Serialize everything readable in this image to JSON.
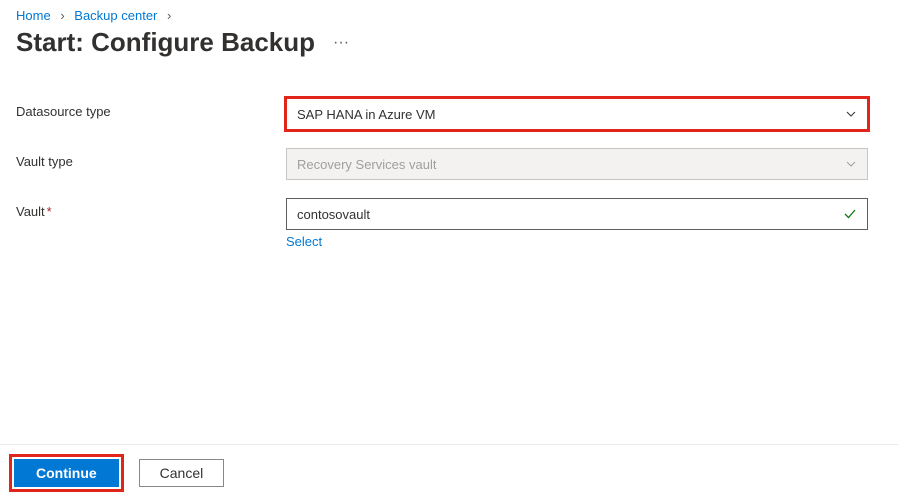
{
  "breadcrumb": {
    "items": [
      "Home",
      "Backup center"
    ]
  },
  "page": {
    "title": "Start: Configure Backup",
    "ellipsis": "···"
  },
  "form": {
    "datasource": {
      "label": "Datasource type",
      "value": "SAP HANA in Azure VM"
    },
    "vault_type": {
      "label": "Vault type",
      "value": "Recovery Services vault"
    },
    "vault": {
      "label": "Vault",
      "required": "*",
      "value": "contosovault",
      "select_link": "Select"
    }
  },
  "footer": {
    "continue": "Continue",
    "cancel": "Cancel"
  }
}
